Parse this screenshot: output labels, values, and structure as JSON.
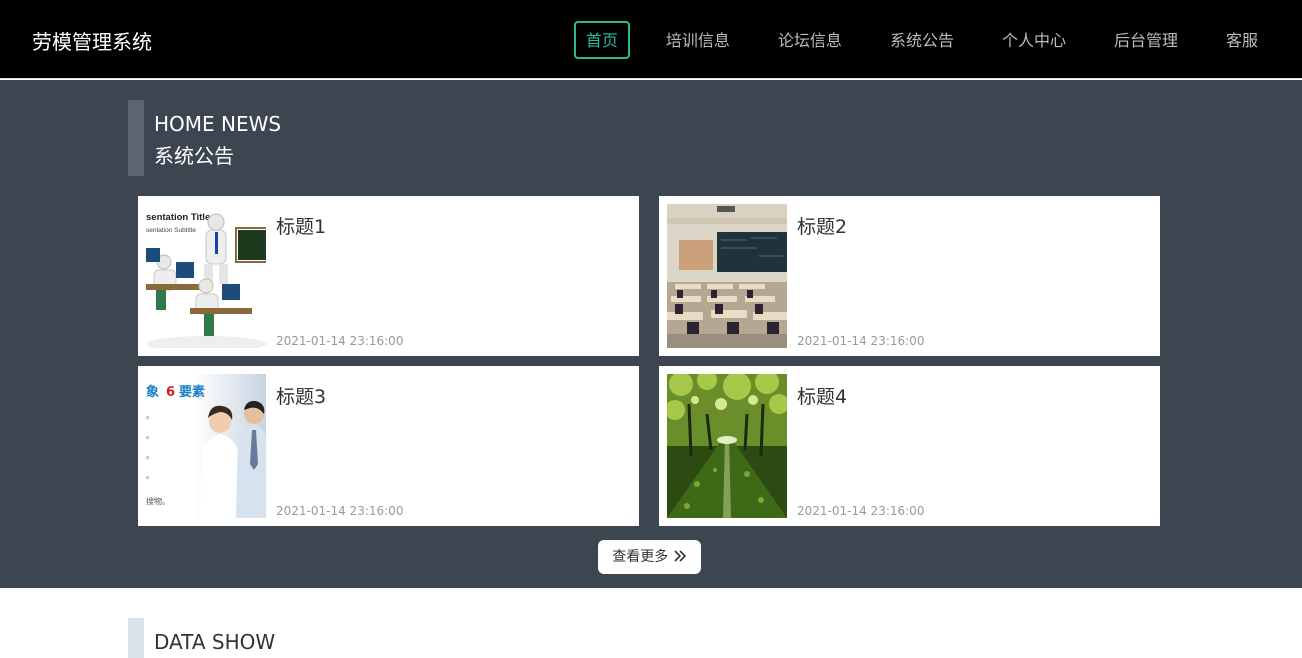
{
  "header": {
    "brand": "劳模管理系统",
    "nav": [
      "首页",
      "培训信息",
      "论坛信息",
      "系统公告",
      "个人中心",
      "后台管理",
      "客服"
    ]
  },
  "news_section": {
    "title_en": "HOME NEWS",
    "title_cn": "系统公告",
    "cards": [
      {
        "title": "标题1",
        "date": "2021-01-14 23:16:00",
        "image": "presentation-classroom-image",
        "image_text": [
          "sentation Title",
          "sentation Subtitle"
        ]
      },
      {
        "title": "标题2",
        "date": "2021-01-14 23:16:00",
        "image": "classroom-photo"
      },
      {
        "title": "标题3",
        "date": "2021-01-14 23:16:00",
        "image": "office-people-image",
        "image_text": [
          "象",
          "6",
          "要素",
          "。",
          "。",
          "。",
          "。",
          "。",
          "搜物。"
        ]
      },
      {
        "title": "标题4",
        "date": "2021-01-14 23:16:00",
        "image": "tree-path-photo"
      }
    ],
    "more_label": "查看更多"
  },
  "data_section": {
    "title_en": "DATA SHOW"
  },
  "colors": {
    "header_bg": "#000000",
    "accent": "#2bb89a",
    "news_bg": "#3d4650"
  }
}
